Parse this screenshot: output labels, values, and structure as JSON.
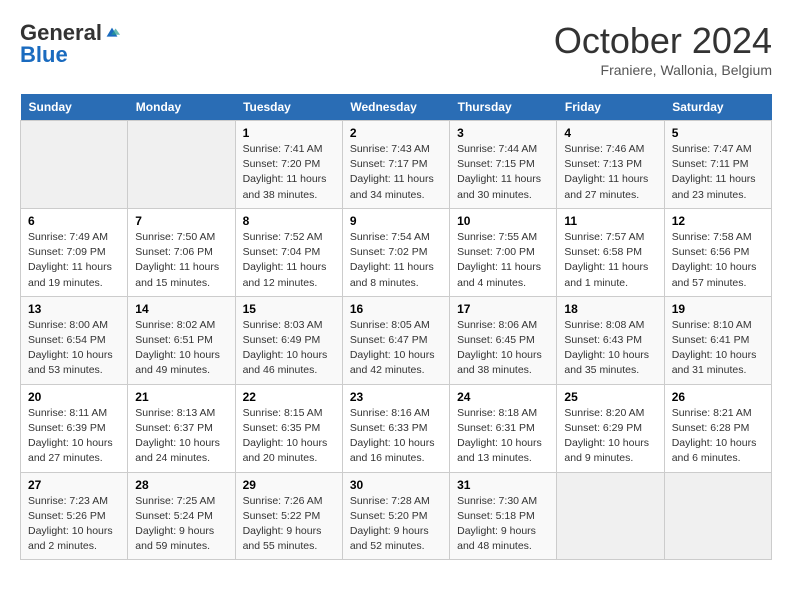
{
  "logo": {
    "general": "General",
    "blue": "Blue"
  },
  "title": "October 2024",
  "subtitle": "Franiere, Wallonia, Belgium",
  "days_of_week": [
    "Sunday",
    "Monday",
    "Tuesday",
    "Wednesday",
    "Thursday",
    "Friday",
    "Saturday"
  ],
  "weeks": [
    [
      {
        "day": "",
        "info": ""
      },
      {
        "day": "",
        "info": ""
      },
      {
        "day": "1",
        "info": "Sunrise: 7:41 AM\nSunset: 7:20 PM\nDaylight: 11 hours and 38 minutes."
      },
      {
        "day": "2",
        "info": "Sunrise: 7:43 AM\nSunset: 7:17 PM\nDaylight: 11 hours and 34 minutes."
      },
      {
        "day": "3",
        "info": "Sunrise: 7:44 AM\nSunset: 7:15 PM\nDaylight: 11 hours and 30 minutes."
      },
      {
        "day": "4",
        "info": "Sunrise: 7:46 AM\nSunset: 7:13 PM\nDaylight: 11 hours and 27 minutes."
      },
      {
        "day": "5",
        "info": "Sunrise: 7:47 AM\nSunset: 7:11 PM\nDaylight: 11 hours and 23 minutes."
      }
    ],
    [
      {
        "day": "6",
        "info": "Sunrise: 7:49 AM\nSunset: 7:09 PM\nDaylight: 11 hours and 19 minutes."
      },
      {
        "day": "7",
        "info": "Sunrise: 7:50 AM\nSunset: 7:06 PM\nDaylight: 11 hours and 15 minutes."
      },
      {
        "day": "8",
        "info": "Sunrise: 7:52 AM\nSunset: 7:04 PM\nDaylight: 11 hours and 12 minutes."
      },
      {
        "day": "9",
        "info": "Sunrise: 7:54 AM\nSunset: 7:02 PM\nDaylight: 11 hours and 8 minutes."
      },
      {
        "day": "10",
        "info": "Sunrise: 7:55 AM\nSunset: 7:00 PM\nDaylight: 11 hours and 4 minutes."
      },
      {
        "day": "11",
        "info": "Sunrise: 7:57 AM\nSunset: 6:58 PM\nDaylight: 11 hours and 1 minute."
      },
      {
        "day": "12",
        "info": "Sunrise: 7:58 AM\nSunset: 6:56 PM\nDaylight: 10 hours and 57 minutes."
      }
    ],
    [
      {
        "day": "13",
        "info": "Sunrise: 8:00 AM\nSunset: 6:54 PM\nDaylight: 10 hours and 53 minutes."
      },
      {
        "day": "14",
        "info": "Sunrise: 8:02 AM\nSunset: 6:51 PM\nDaylight: 10 hours and 49 minutes."
      },
      {
        "day": "15",
        "info": "Sunrise: 8:03 AM\nSunset: 6:49 PM\nDaylight: 10 hours and 46 minutes."
      },
      {
        "day": "16",
        "info": "Sunrise: 8:05 AM\nSunset: 6:47 PM\nDaylight: 10 hours and 42 minutes."
      },
      {
        "day": "17",
        "info": "Sunrise: 8:06 AM\nSunset: 6:45 PM\nDaylight: 10 hours and 38 minutes."
      },
      {
        "day": "18",
        "info": "Sunrise: 8:08 AM\nSunset: 6:43 PM\nDaylight: 10 hours and 35 minutes."
      },
      {
        "day": "19",
        "info": "Sunrise: 8:10 AM\nSunset: 6:41 PM\nDaylight: 10 hours and 31 minutes."
      }
    ],
    [
      {
        "day": "20",
        "info": "Sunrise: 8:11 AM\nSunset: 6:39 PM\nDaylight: 10 hours and 27 minutes."
      },
      {
        "day": "21",
        "info": "Sunrise: 8:13 AM\nSunset: 6:37 PM\nDaylight: 10 hours and 24 minutes."
      },
      {
        "day": "22",
        "info": "Sunrise: 8:15 AM\nSunset: 6:35 PM\nDaylight: 10 hours and 20 minutes."
      },
      {
        "day": "23",
        "info": "Sunrise: 8:16 AM\nSunset: 6:33 PM\nDaylight: 10 hours and 16 minutes."
      },
      {
        "day": "24",
        "info": "Sunrise: 8:18 AM\nSunset: 6:31 PM\nDaylight: 10 hours and 13 minutes."
      },
      {
        "day": "25",
        "info": "Sunrise: 8:20 AM\nSunset: 6:29 PM\nDaylight: 10 hours and 9 minutes."
      },
      {
        "day": "26",
        "info": "Sunrise: 8:21 AM\nSunset: 6:28 PM\nDaylight: 10 hours and 6 minutes."
      }
    ],
    [
      {
        "day": "27",
        "info": "Sunrise: 7:23 AM\nSunset: 5:26 PM\nDaylight: 10 hours and 2 minutes."
      },
      {
        "day": "28",
        "info": "Sunrise: 7:25 AM\nSunset: 5:24 PM\nDaylight: 9 hours and 59 minutes."
      },
      {
        "day": "29",
        "info": "Sunrise: 7:26 AM\nSunset: 5:22 PM\nDaylight: 9 hours and 55 minutes."
      },
      {
        "day": "30",
        "info": "Sunrise: 7:28 AM\nSunset: 5:20 PM\nDaylight: 9 hours and 52 minutes."
      },
      {
        "day": "31",
        "info": "Sunrise: 7:30 AM\nSunset: 5:18 PM\nDaylight: 9 hours and 48 minutes."
      },
      {
        "day": "",
        "info": ""
      },
      {
        "day": "",
        "info": ""
      }
    ]
  ]
}
